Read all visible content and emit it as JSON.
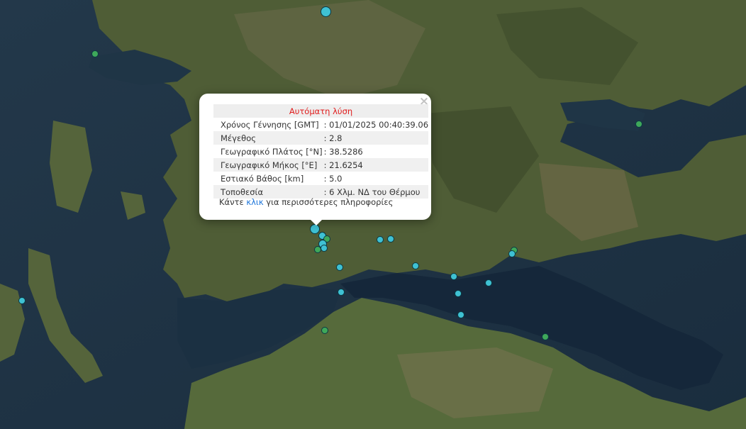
{
  "colors": {
    "marker_cyan": "#3fc1d3",
    "marker_green": "#3fa85a",
    "popup_title": "#e01b1b",
    "link": "#1a73d9",
    "sea": "#1f3342",
    "land": "#5a6a3f"
  },
  "popup": {
    "close_icon": "×",
    "title": "Αυτόματη λύση",
    "rows": [
      {
        "label": "Χρόνος Γέννησης [GMT]",
        "value": ": 01/01/2025 00:40:39.06"
      },
      {
        "label": "Μέγεθος",
        "value": ": 2.8"
      },
      {
        "label": "Γεωγραφικό Πλάτος [°N]",
        "value": ": 38.5286"
      },
      {
        "label": "Γεωγραφικό Μήκος [°E]",
        "value": ": 21.6254"
      },
      {
        "label": "Εστιακό Βάθος [km]",
        "value": ": 5.0"
      },
      {
        "label": "Τοποθεσία",
        "value": ": 6 Χλμ. ΝΔ του Θέρμου"
      }
    ],
    "more_prefix": "Κάντε ",
    "more_link": "κλικ",
    "more_suffix": " για περισσότερες πληροφορίες"
  }
}
